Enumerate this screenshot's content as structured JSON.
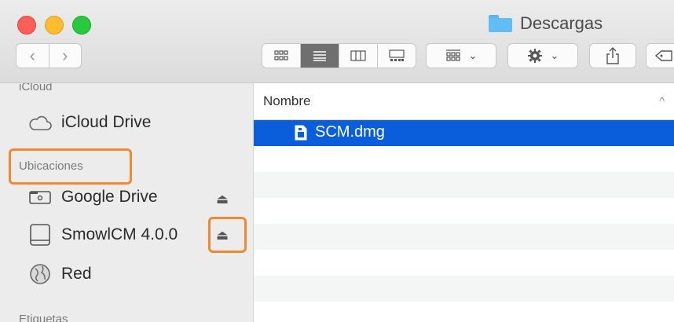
{
  "window": {
    "title": "Descargas"
  },
  "sidebar": {
    "sections": [
      {
        "heading": "iCloud",
        "items": [
          {
            "label": "iCloud Drive",
            "icon": "cloud-icon"
          }
        ]
      },
      {
        "heading": "Ubicaciones",
        "items": [
          {
            "label": "Google Drive",
            "icon": "drive-icon",
            "eject": "⏏"
          },
          {
            "label": "SmowlCM 4.0.0",
            "icon": "disk-icon",
            "eject": "⏏"
          },
          {
            "label": "Red",
            "icon": "globe-icon"
          }
        ]
      },
      {
        "heading": "Etiquetas",
        "items": []
      }
    ]
  },
  "list": {
    "column_header": "Nombre",
    "sort_glyph": "^",
    "files": [
      {
        "name": "SCM.dmg",
        "icon": "document-icon",
        "selected": true
      }
    ]
  },
  "colors": {
    "selection": "#0a5ddb",
    "highlight": "#f08a30"
  }
}
